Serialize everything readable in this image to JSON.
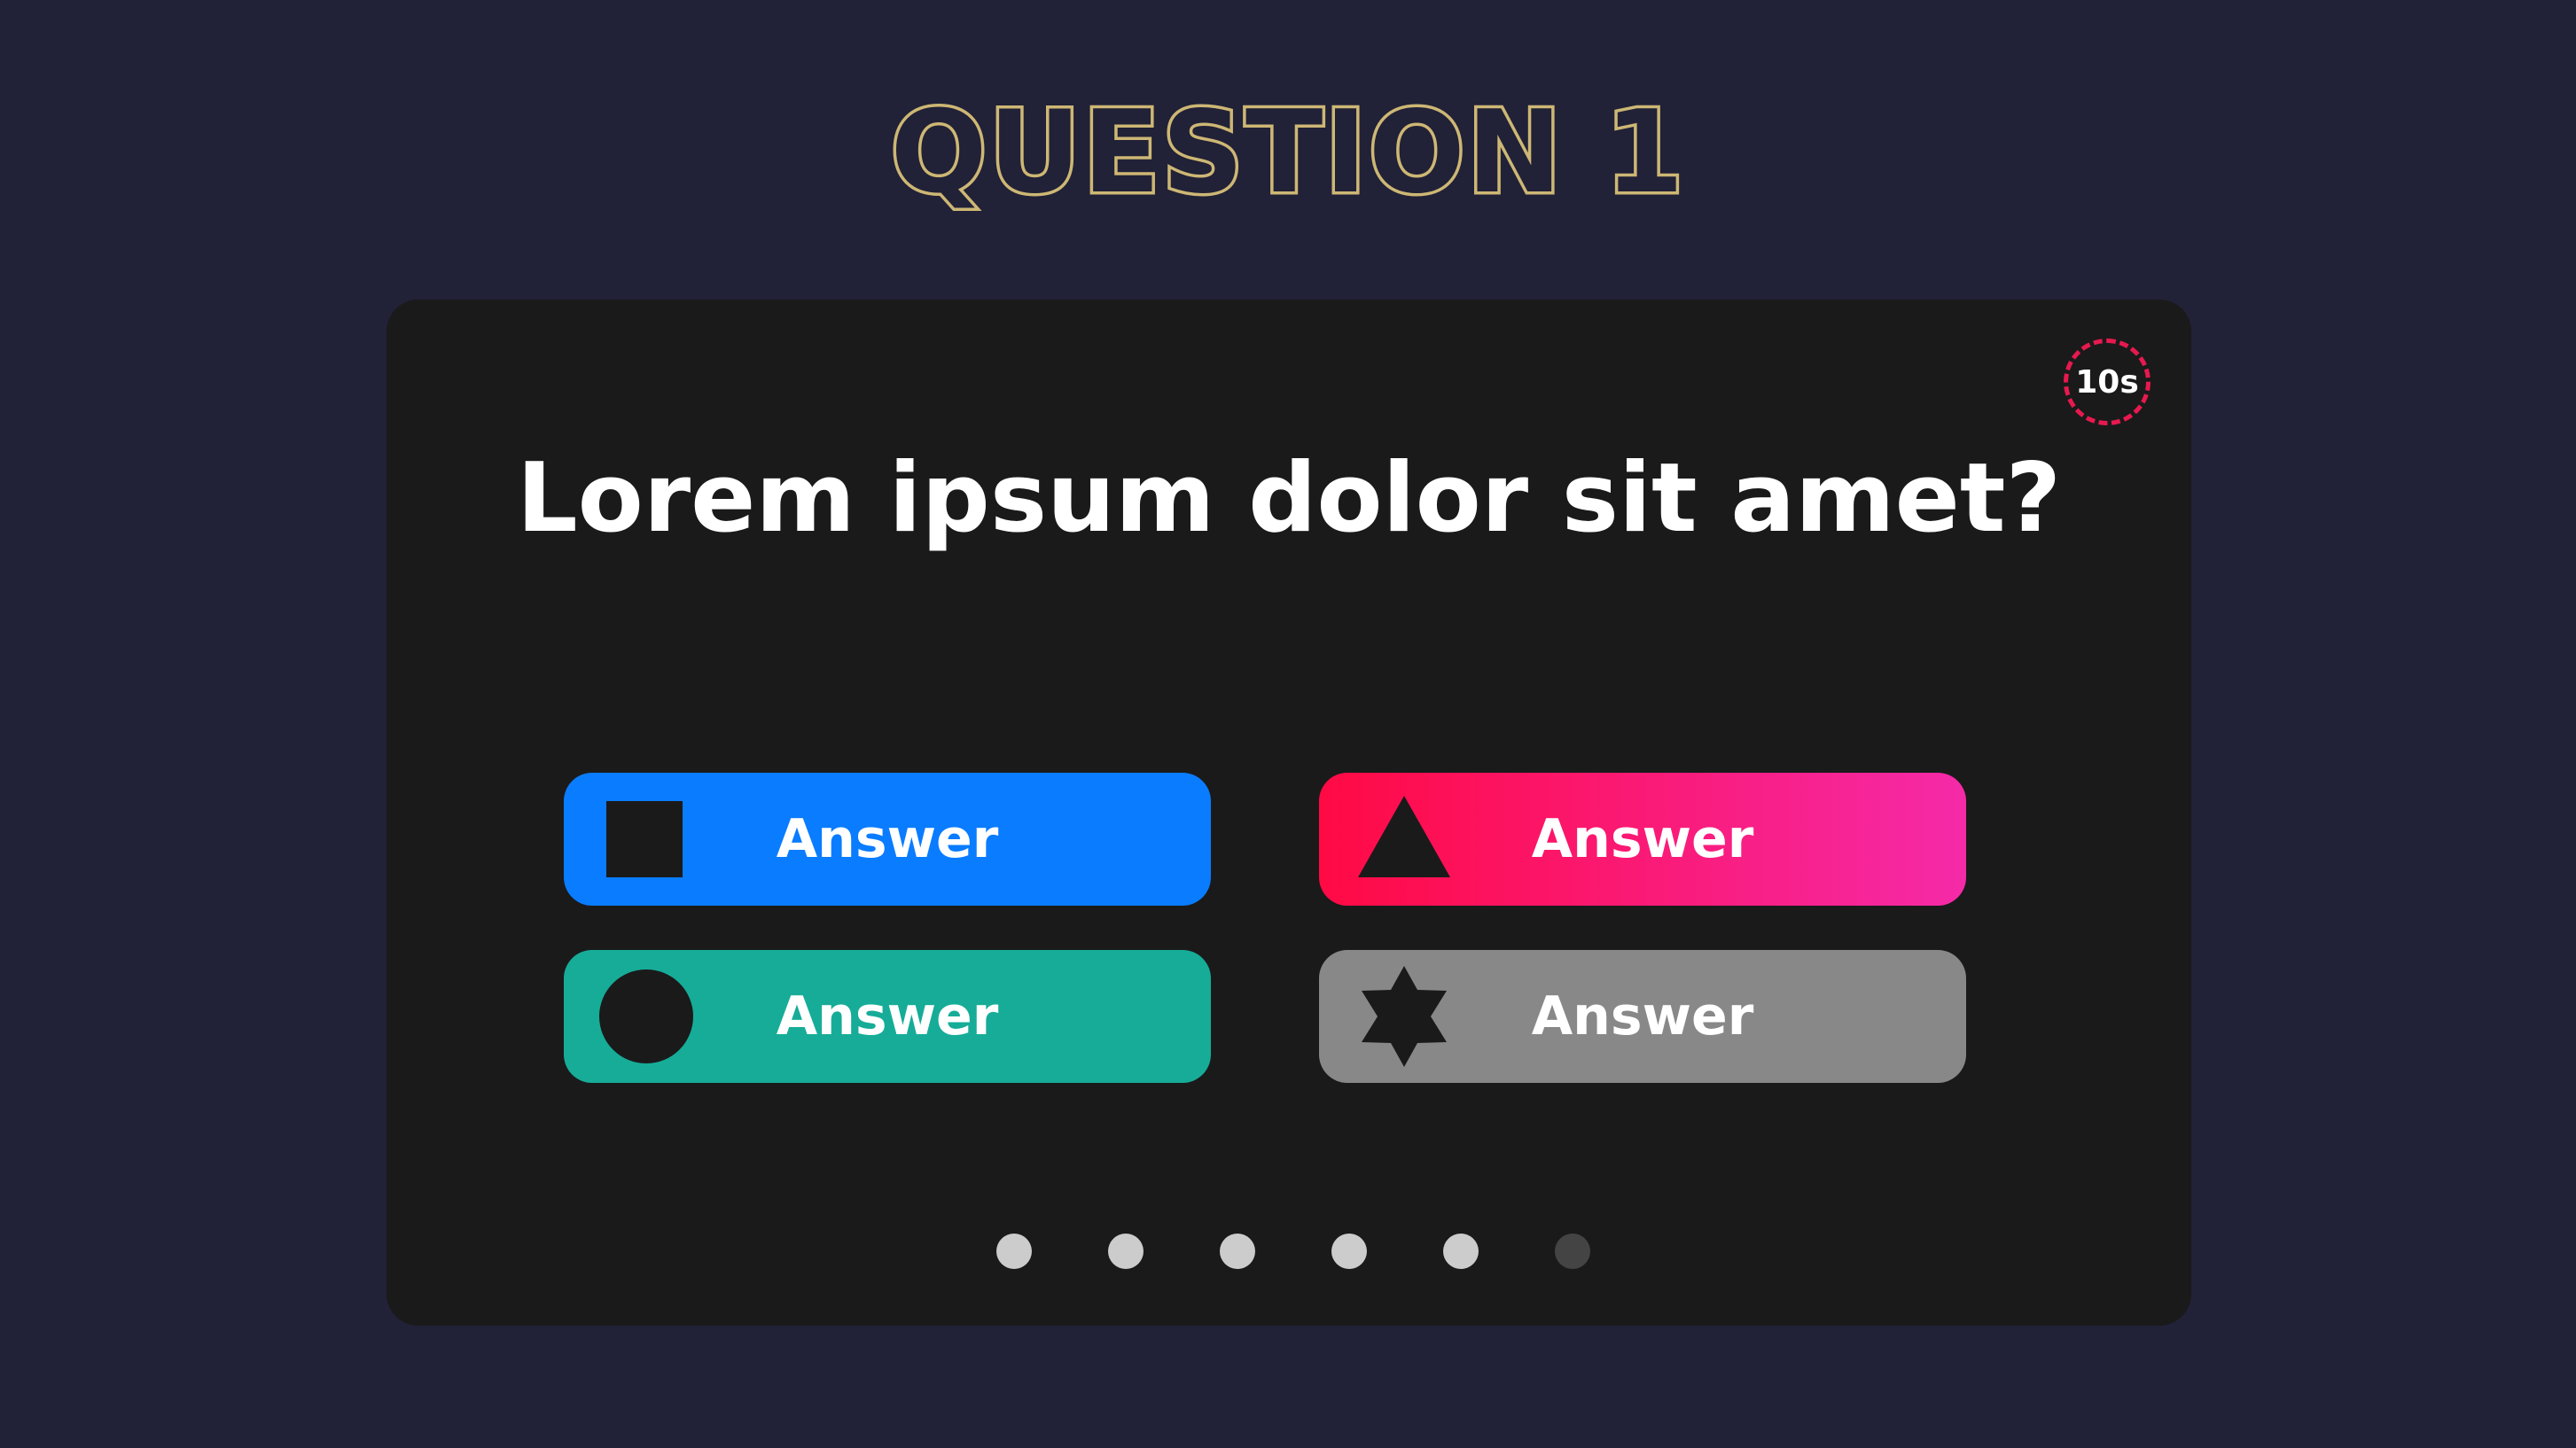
{
  "heading": "QUESTION 1",
  "timer": {
    "label": "10s",
    "color": "#e8194f"
  },
  "question": "Lorem ipsum dolor sit amet?",
  "answers": [
    {
      "label": "Answer",
      "shape": "square-icon",
      "color": "#0a7cff"
    },
    {
      "label": "Answer",
      "shape": "triangle-icon",
      "color": "#ff0a44"
    },
    {
      "label": "Answer",
      "shape": "circle-icon",
      "color": "#16ac98"
    },
    {
      "label": "Answer",
      "shape": "star-icon",
      "color": "#888888"
    }
  ],
  "progress": {
    "total": 6,
    "current": 6
  },
  "colors": {
    "background": "#212137",
    "card": "#1a1a1a",
    "heading": "#cdb774",
    "dot_done": "#cccccc",
    "dot_pending": "#444444"
  }
}
